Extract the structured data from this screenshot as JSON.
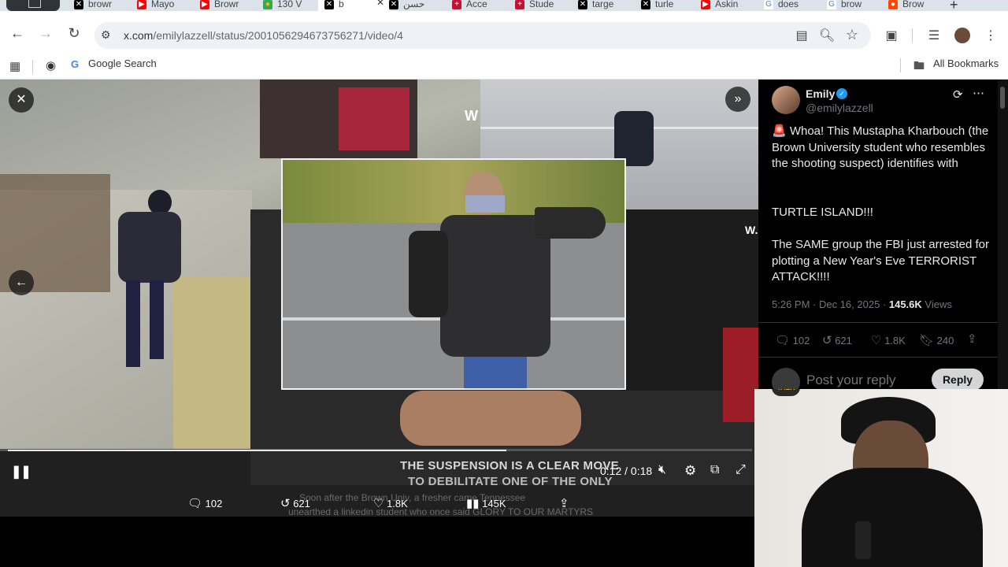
{
  "tabs": [
    {
      "icon": "x-icon",
      "label": "browr"
    },
    {
      "icon": "youtube-icon",
      "label": "Mayo"
    },
    {
      "icon": "youtube-icon",
      "label": "Browr"
    },
    {
      "icon": "maps-icon",
      "label": "130 V"
    },
    {
      "icon": "x-icon",
      "label": "b",
      "active": true
    },
    {
      "icon": "x-icon",
      "label": "حسن"
    },
    {
      "icon": "uk-flag-icon",
      "label": "Acce"
    },
    {
      "icon": "uk-flag-icon",
      "label": "Stude"
    },
    {
      "icon": "x-icon",
      "label": "targe"
    },
    {
      "icon": "x-icon",
      "label": "turle"
    },
    {
      "icon": "youtube-icon",
      "label": "Askin"
    },
    {
      "icon": "google-icon",
      "label": "does"
    },
    {
      "icon": "google-icon",
      "label": "brow"
    },
    {
      "icon": "reddit-icon",
      "label": "Brow"
    }
  ],
  "new_tab_label": "+",
  "address": {
    "domain": "x.com",
    "path": "/emilylazzell/status/2001056294673756271/video/4"
  },
  "bookmarks": {
    "google_search": "Google Search",
    "all_bookmarks": "All Bookmarks"
  },
  "video": {
    "overlay_text_1": "W",
    "overlay_text_2": "W.",
    "caption_1": "THE SUSPENSION IS A CLEAR MOVE",
    "caption_2": "TO DEBILITATE ONE OF THE ONLY",
    "subtext_1": "Soon after the Brown Univ, a fresher came Tennessee",
    "subtext_2": "unearthed a linkedin student who once said GLORY TO OUR MARTYRS",
    "time": "0:12 / 0:18",
    "progress": 0.67
  },
  "video_stats": {
    "replies": "102",
    "reposts": "621",
    "likes": "1.8K",
    "views": "145K"
  },
  "tweet": {
    "name": "Emily",
    "handle": "@emilylazzell",
    "line1": "🚨 Whoa! This Mustapha Kharbouch (the Brown University student who resembles the shooting suspect) identifies with",
    "line2": "TURTLE ISLAND!!!",
    "line3": "The SAME group the FBI just arrested for plotting a New Year's Eve TERRORIST ATTACK!!!!",
    "timestamp": "5:26 PM · Dec 16, 2025 · ",
    "views_count": "145.6K",
    "views_label": " Views",
    "replies": "102",
    "reposts": "621",
    "likes": "1.8K",
    "bookmarks": "240",
    "reply_placeholder": "Post your reply",
    "reply_button": "Reply"
  },
  "webcam": {
    "badge": "TALK"
  },
  "colors": {
    "verified": "#1d9bf0",
    "reply_button": "#d3d5d7",
    "x_bg": "#000000"
  }
}
